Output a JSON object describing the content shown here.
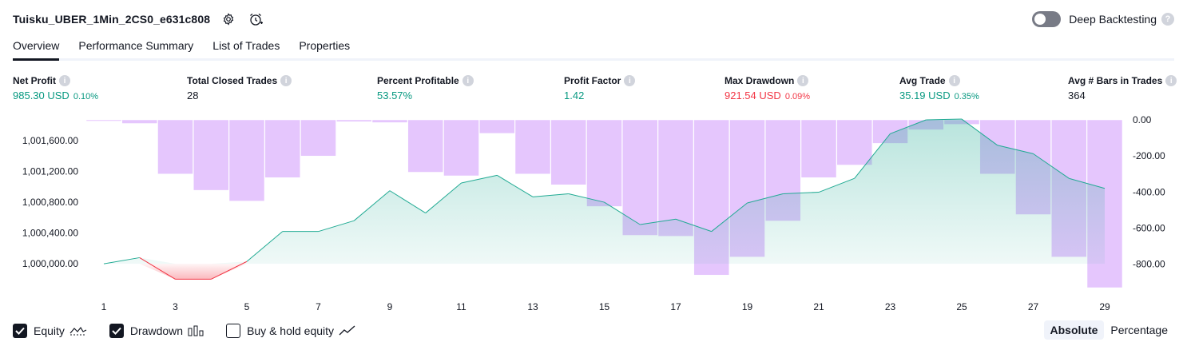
{
  "header": {
    "strategy_name": "Tuisku_UBER_1Min_2CS0_e631c808",
    "settings_icon": "gear-icon",
    "alert_icon": "alarm-clock-add-icon"
  },
  "deep_backtesting": {
    "label": "Deep Backtesting",
    "enabled": false,
    "help": "?"
  },
  "tabs": [
    {
      "label": "Overview",
      "active": true
    },
    {
      "label": "Performance Summary",
      "active": false
    },
    {
      "label": "List of Trades",
      "active": false
    },
    {
      "label": "Properties",
      "active": false
    }
  ],
  "stats": {
    "net_profit": {
      "label": "Net Profit",
      "value": "985.30 USD",
      "pct": "0.10%"
    },
    "total_closed_trades": {
      "label": "Total Closed Trades",
      "value": "28"
    },
    "percent_profitable": {
      "label": "Percent Profitable",
      "value": "53.57%"
    },
    "profit_factor": {
      "label": "Profit Factor",
      "value": "1.42"
    },
    "max_drawdown": {
      "label": "Max Drawdown",
      "value": "921.54 USD",
      "pct": "0.09%"
    },
    "avg_trade": {
      "label": "Avg Trade",
      "value": "35.19 USD",
      "pct": "0.35%"
    },
    "avg_bars": {
      "label": "Avg # Bars in Trades",
      "value": "364"
    },
    "info_glyph": "i"
  },
  "colors": {
    "positive": "#089981",
    "negative": "#f23645",
    "drawdown_bar": "#e1bcfd",
    "equity_line": "#22ab94"
  },
  "chart_data": {
    "type": "area",
    "x": [
      1,
      2,
      3,
      4,
      5,
      6,
      7,
      8,
      9,
      10,
      11,
      12,
      13,
      14,
      15,
      16,
      17,
      18,
      19,
      20,
      21,
      22,
      23,
      24,
      25,
      26,
      27,
      28,
      29
    ],
    "xticks": [
      "1",
      "3",
      "5",
      "7",
      "9",
      "11",
      "13",
      "15",
      "17",
      "19",
      "21",
      "23",
      "25",
      "27",
      "29"
    ],
    "equity": {
      "name": "Equity",
      "values": [
        1000000,
        1000080,
        999800,
        999800,
        1000030,
        1000420,
        1000420,
        1000560,
        1000950,
        1000660,
        1001050,
        1001150,
        1000870,
        1000910,
        1000800,
        1000510,
        1000580,
        1000420,
        1000790,
        1000910,
        1000930,
        1001110,
        1001690,
        1001870,
        1001880,
        1001540,
        1001430,
        1001110,
        1000980
      ],
      "base": 1000000
    },
    "drawdown": {
      "name": "Drawdown",
      "values": [
        -5,
        -20,
        -300,
        -390,
        -450,
        -320,
        -200,
        -10,
        -15,
        -290,
        -310,
        -75,
        -300,
        -360,
        -480,
        -640,
        -645,
        -860,
        -760,
        -560,
        -320,
        -250,
        -130,
        -55,
        -25,
        -300,
        -525,
        -760,
        -930
      ]
    },
    "left_axis": {
      "ticks": [
        "1,001,600.00",
        "1,001,200.00",
        "1,000,800.00",
        "1,000,400.00",
        "1,000,000.00"
      ],
      "tick_values": [
        1001600,
        1001200,
        1000800,
        1000400,
        1000000
      ],
      "range": [
        999690,
        1001870
      ]
    },
    "right_axis": {
      "ticks": [
        "0.00",
        "-200.00",
        "-400.00",
        "-600.00",
        "-800.00"
      ],
      "tick_values": [
        0,
        -200,
        -400,
        -600,
        -800
      ],
      "range": [
        -930,
        0
      ]
    },
    "grid": false
  },
  "legend": {
    "equity": {
      "label": "Equity",
      "checked": true
    },
    "drawdown": {
      "label": "Drawdown",
      "checked": true
    },
    "buy_hold": {
      "label": "Buy & hold equity",
      "checked": false
    }
  },
  "scale": {
    "absolute": "Absolute",
    "percentage": "Percentage",
    "active": "absolute"
  }
}
